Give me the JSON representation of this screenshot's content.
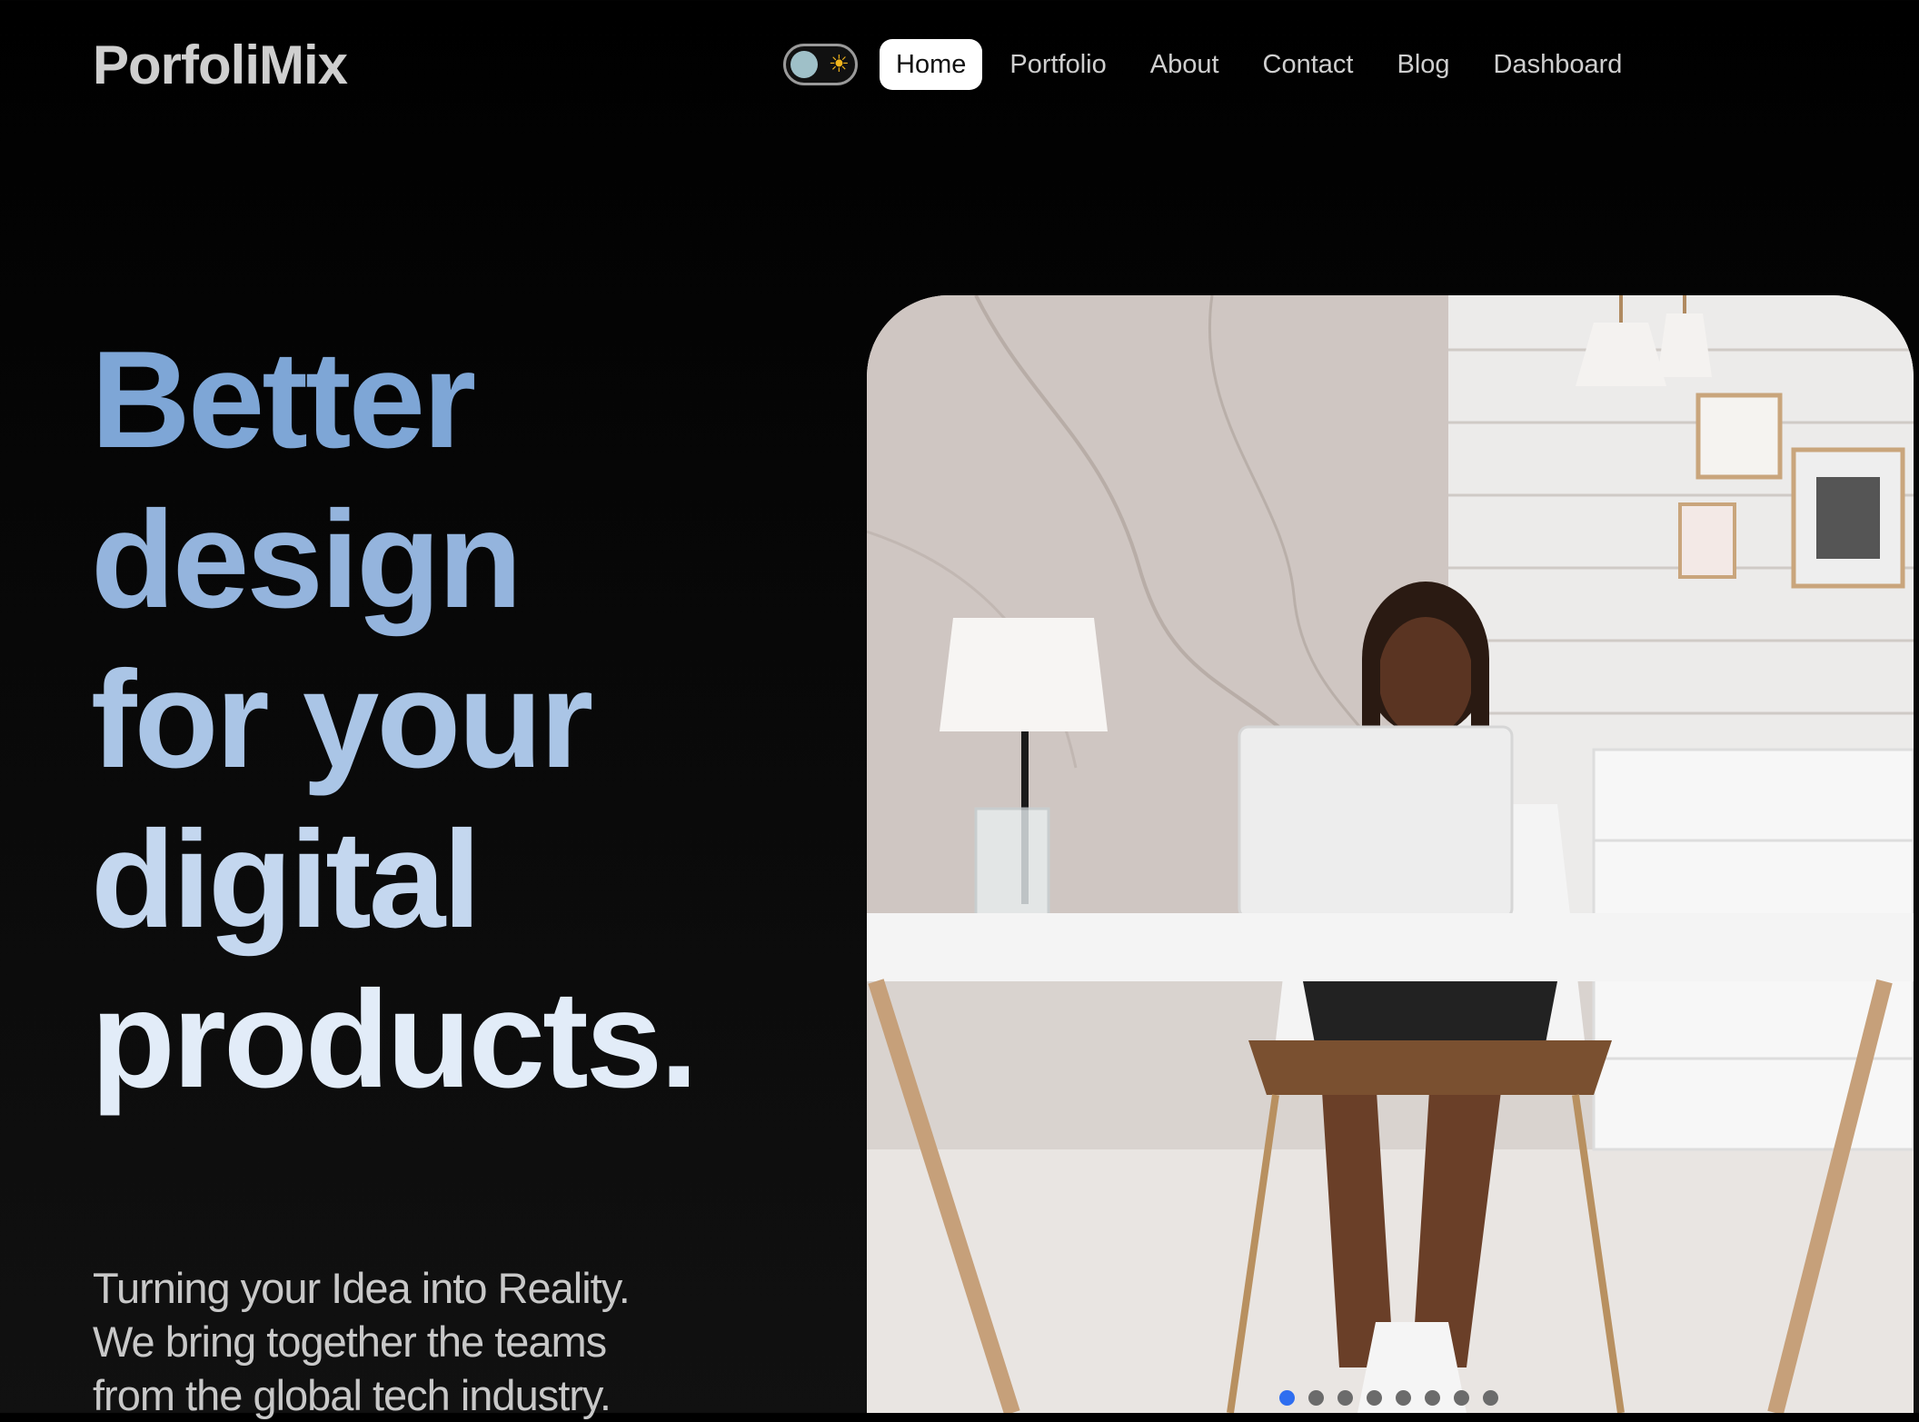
{
  "brand": {
    "name": "PorfoliMix"
  },
  "theme_toggle": {
    "icon": "sun-icon",
    "knob_color": "#9fc0c8"
  },
  "nav": {
    "items": [
      {
        "label": "Home",
        "active": true
      },
      {
        "label": "Portfolio",
        "active": false
      },
      {
        "label": "About",
        "active": false
      },
      {
        "label": "Contact",
        "active": false
      },
      {
        "label": "Blog",
        "active": false
      },
      {
        "label": "Dashboard",
        "active": false
      }
    ]
  },
  "hero": {
    "headline": [
      "Better",
      "design",
      "for your",
      "digital",
      "products."
    ],
    "tagline": [
      "Turning your Idea into Reality.",
      "We bring together the teams",
      "from the global tech industry."
    ]
  },
  "carousel": {
    "slide_count": 8,
    "active_index": 0,
    "active_color": "#2f6ef0"
  },
  "colors": {
    "background": "#000000",
    "headline_top": "#7ea6d6",
    "headline_bottom": "#e2ecf8"
  }
}
